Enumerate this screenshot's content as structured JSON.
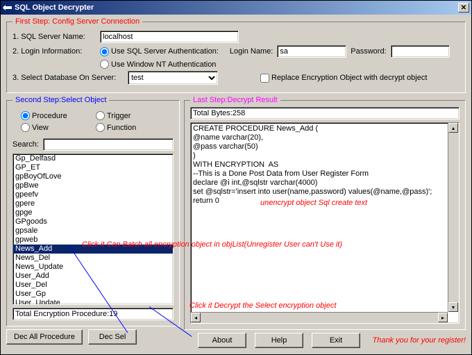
{
  "titlebar": {
    "title": "SQL Object Decrypter"
  },
  "step1": {
    "legend": "First Step: Config Server Connection",
    "server_label": "1. SQL Server Name:",
    "server_value": "localhost",
    "login_label": "2. Login Information:",
    "auth_sql_label": "Use SQL Server Authentication:",
    "auth_nt_label": "Use Window NT Authentication",
    "login_name_label": "Login Name:",
    "login_name_value": "sa",
    "password_label": "Password:",
    "password_value": "",
    "db_label": "3. Select Database On Server:",
    "db_value": "test",
    "replace_label": "Replace Encryption Object with decrypt object"
  },
  "step2": {
    "legend": "Second Step:Select Object",
    "radio": {
      "procedure": "Procedure",
      "trigger": "Trigger",
      "view": "View",
      "function": "Function"
    },
    "search_label": "Search:",
    "search_value": "",
    "items": [
      "Gp_Delfasd",
      "GP_ET",
      "gpBoyOfLove",
      "gpBwe",
      "gpeefv",
      "gpere",
      "gpge",
      "GPgoods",
      "gpsale",
      "gpweb",
      "News_Add",
      "News_Del",
      "News_Update",
      "User_Add",
      "User_Del",
      "User_Gp",
      "User_Update"
    ],
    "selected_index": 10,
    "count": "Total Encryption Procedure:19",
    "btn_all": "Dec All Procedure",
    "btn_sel": "Dec Sel"
  },
  "step3": {
    "legend": "Last Step:Decrypt Result",
    "total_bytes": "Total Bytes:258",
    "result": "CREATE PROCEDURE News_Add (\n@name varchar(20),\n@pass varchar(50)\n)\nWITH ENCRYPTION  AS\n--This is a Done Post Data from User Register Form\ndeclare @i int,@sqlstr varchar(4000)\nset @sqlstr='insert into user(name,password) values(@name,@pass)';\nreturn 0"
  },
  "footer": {
    "about": "About",
    "help": "Help",
    "exit": "Exit",
    "thankyou": "Thank you for your register!"
  },
  "annotations": {
    "a1": "unencrypt object Sql create text",
    "a2": "Click it Can Batch all encryption object in objList(Unregister User can't Use it)",
    "a3": "Click it Decrypt the Select encryption object"
  }
}
